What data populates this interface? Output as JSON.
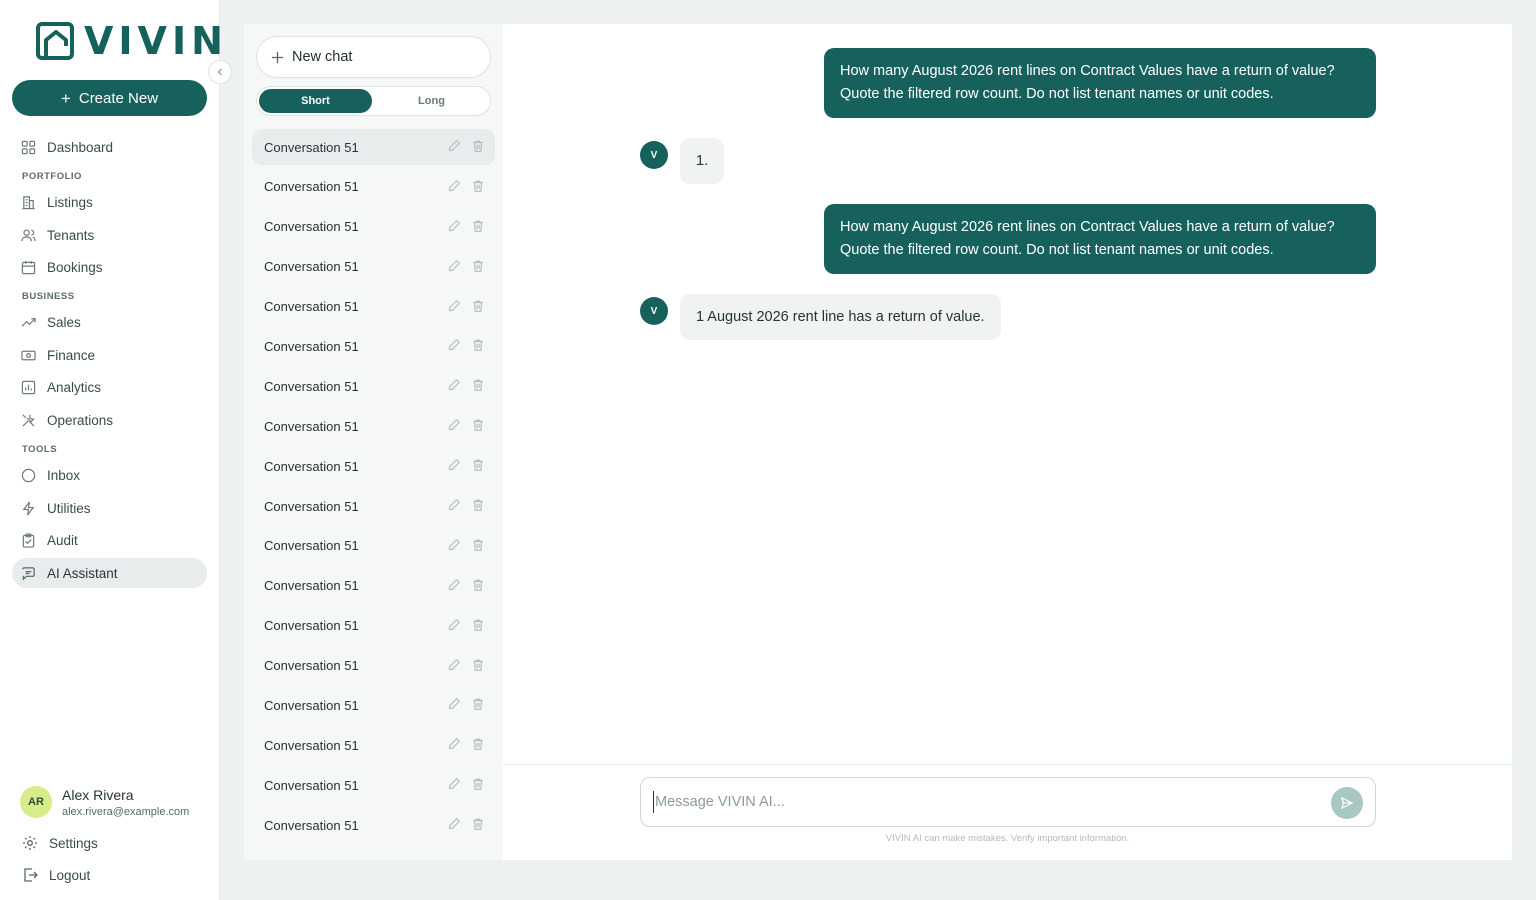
{
  "brand": {
    "name": "VIVIN",
    "accent": "#17615c"
  },
  "sidebar": {
    "create_label": "Create New",
    "dashboard": "Dashboard",
    "sections": {
      "portfolio": "PORTFOLIO",
      "business": "BUSINESS",
      "tools": "TOOLS"
    },
    "items": {
      "listings": "Listings",
      "tenants": "Tenants",
      "bookings": "Bookings",
      "sales": "Sales",
      "finance": "Finance",
      "analytics": "Analytics",
      "operations": "Operations",
      "inbox": "Inbox",
      "utilities": "Utilities",
      "audit": "Audit",
      "ai_assistant": "AI Assistant"
    },
    "user": {
      "initials": "AR",
      "name": "Alex Rivera",
      "email": "alex.rivera@example.com"
    },
    "settings": "Settings",
    "logout": "Logout"
  },
  "conversations": {
    "new_chat": "New chat",
    "toggle": {
      "short": "Short",
      "long": "Long",
      "selected": "Short"
    },
    "items": [
      "Conversation 51",
      "Conversation 51",
      "Conversation 51",
      "Conversation 51",
      "Conversation 51",
      "Conversation 51",
      "Conversation 51",
      "Conversation 51",
      "Conversation 51",
      "Conversation 51",
      "Conversation 51",
      "Conversation 51",
      "Conversation 51",
      "Conversation 51",
      "Conversation 51",
      "Conversation 51",
      "Conversation 51",
      "Conversation 51"
    ]
  },
  "chat": {
    "bot_initial": "V",
    "messages": [
      {
        "role": "user",
        "text": "How many August 2026 rent lines on Contract Values have a return of value? Quote the filtered row count. Do not list tenant names or unit codes."
      },
      {
        "role": "bot",
        "text": "1."
      },
      {
        "role": "user",
        "text": "How many August 2026 rent lines on Contract Values have a return of value? Quote the filtered row count. Do not list tenant names or unit codes."
      },
      {
        "role": "bot",
        "text": "1 August 2026 rent line has a return of value."
      }
    ],
    "input_placeholder": "Message VIVIN AI...",
    "disclaimer": "VIVIN AI can make mistakes. Verify important information."
  }
}
